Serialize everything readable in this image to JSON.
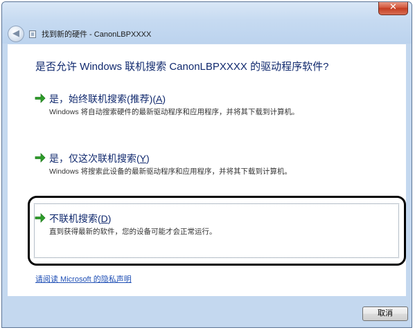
{
  "window": {
    "title": "找到新的硬件 - CanonLBPXXXX",
    "close_label": "✕"
  },
  "question": "是否允许 Windows 联机搜索 CanonLBPXXXX 的驱动程序软件?",
  "options": [
    {
      "title": "是，始终联机搜索(推荐)(",
      "accel": "A",
      "title_end": ")",
      "description": "Windows 将自动搜索硬件的最新驱动程序和应用程序，并将其下载到计算机。"
    },
    {
      "title": "是，仅这次联机搜索(",
      "accel": "Y",
      "title_end": ")",
      "description": "Windows 将搜索此设备的最新驱动程序和应用程序，并将其下载到计算机。"
    },
    {
      "title": "不联机搜索(",
      "accel": "D",
      "title_end": ")",
      "description": "直到获得最新的软件，您的设备可能才会正常运行。"
    }
  ],
  "privacy_link": "请阅读 Microsoft 的隐私声明",
  "cancel_label": "取消",
  "colors": {
    "arrow": "#2e9e2a",
    "link": "#10296e"
  },
  "icons": {
    "back": "back-arrow-icon",
    "option": "green-arrow-icon",
    "dialog": "hardware-dialog-icon"
  }
}
